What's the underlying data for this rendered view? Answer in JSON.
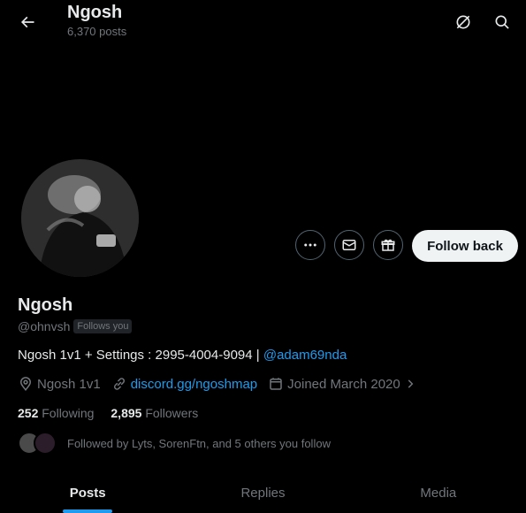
{
  "header": {
    "title": "Ngosh",
    "posts_count": "6,370 posts"
  },
  "profile": {
    "name": "Ngosh",
    "handle": "@ohnvsh",
    "follows_you": "Follows you",
    "bio_text": "Ngosh 1v1 + Settings : 2995-4004-9094 | ",
    "bio_mention": "@adam69nda",
    "location": "Ngosh 1v1",
    "website": "discord.gg/ngoshmap",
    "joined": "Joined March 2020",
    "following_count": "252",
    "following_label": "Following",
    "followers_count": "2,895",
    "followers_label": "Followers",
    "followed_by": "Followed by Lyts, SorenFtn, and 5 others you follow"
  },
  "actions": {
    "follow_back": "Follow back"
  },
  "tabs": [
    {
      "label": "Posts",
      "active": true
    },
    {
      "label": "Replies",
      "active": false
    },
    {
      "label": "Media",
      "active": false
    }
  ],
  "colors": {
    "background": "#000000",
    "text": "#e7e9ea",
    "muted": "#71767b",
    "accent": "#1d9bf0"
  }
}
